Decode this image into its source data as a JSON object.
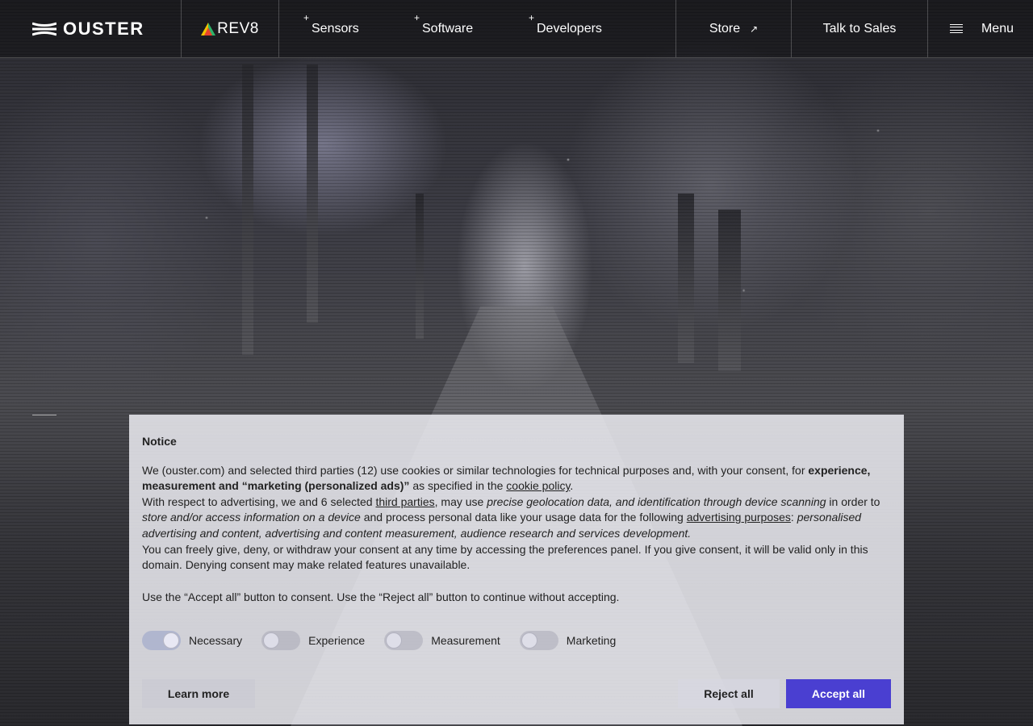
{
  "header": {
    "brand": "OUSTER",
    "rev8": "REV8",
    "nav": [
      {
        "label": "Sensors"
      },
      {
        "label": "Software"
      },
      {
        "label": "Developers"
      }
    ],
    "store_label": "Store",
    "store_arrow": "↗",
    "sales_label": "Talk to Sales",
    "menu_label": "Menu"
  },
  "notice": {
    "title": "Notice",
    "p1": {
      "a": "We (ouster.com) and selected third parties (12) use cookies or similar technologies for technical purposes and, with your consent, for ",
      "b": "experience, measurement and “marketing (personalized ads)”",
      "c": " as specified in the ",
      "link": "cookie policy",
      "d": "."
    },
    "p2": {
      "a": "With respect to advertising, we and 6 selected ",
      "link1": "third parties",
      "b": ", may use ",
      "c": "precise geolocation data, and identification through device scanning",
      "d": " in order to ",
      "e": "store and/or access information on a device",
      "f": " and process personal data like your usage data for the following ",
      "link2": "advertising purposes",
      "g": ": ",
      "h": "personalised advertising and content, advertising and content measurement, audience research and services development."
    },
    "p3": "You can freely give, deny, or withdraw your consent at any time by accessing the preferences panel. If you give consent, it will be valid only in this domain. Denying consent may make related features unavailable.",
    "p4": "Use the “Accept all” button to consent. Use the “Reject all” button to continue without accepting.",
    "toggles": [
      {
        "label": "Necessary",
        "on": true
      },
      {
        "label": "Experience",
        "on": false
      },
      {
        "label": "Measurement",
        "on": false
      },
      {
        "label": "Marketing",
        "on": false
      }
    ],
    "learn_more": "Learn more",
    "reject_all": "Reject all",
    "accept_all": "Accept all"
  },
  "colors": {
    "accent": "#4a3fd1",
    "rev8_triangle": [
      "#f2c200",
      "#e8442c",
      "#2eb36a"
    ]
  },
  "icons": [
    "ouster-logo-icon",
    "rev8-triangle-icon",
    "plus-icon",
    "external-arrow-icon",
    "hamburger-menu-icon"
  ]
}
